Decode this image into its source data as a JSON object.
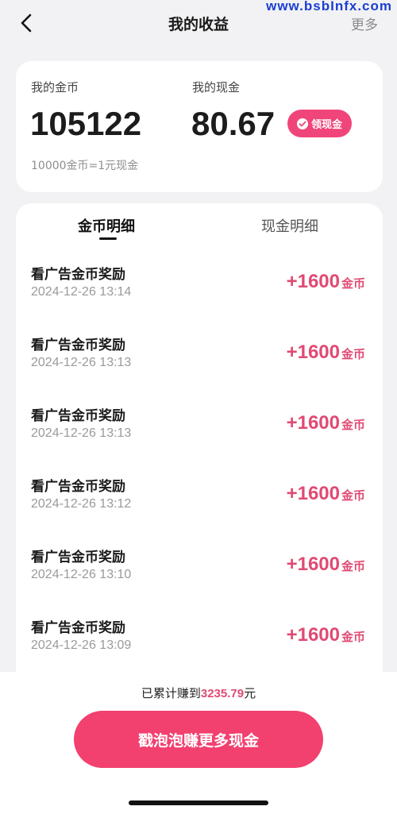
{
  "watermark": "www.bsbInfx.com",
  "nav": {
    "title": "我的收益",
    "more_label": "更多"
  },
  "summary": {
    "coins_label": "我的金币",
    "coins_value": "105122",
    "cash_label": "我的现金",
    "cash_value": "80.67",
    "claim_label": "领现金",
    "rate_text": "10000金币=1元现金"
  },
  "tabs": [
    {
      "label": "金币明细",
      "active": true
    },
    {
      "label": "现金明细",
      "active": false
    }
  ],
  "records": [
    {
      "title": "看广告金币奖励",
      "time": "2024-12-26 13:14",
      "amount": "+1600",
      "unit": "金币"
    },
    {
      "title": "看广告金币奖励",
      "time": "2024-12-26 13:13",
      "amount": "+1600",
      "unit": "金币"
    },
    {
      "title": "看广告金币奖励",
      "time": "2024-12-26 13:13",
      "amount": "+1600",
      "unit": "金币"
    },
    {
      "title": "看广告金币奖励",
      "time": "2024-12-26 13:12",
      "amount": "+1600",
      "unit": "金币"
    },
    {
      "title": "看广告金币奖励",
      "time": "2024-12-26 13:10",
      "amount": "+1600",
      "unit": "金币"
    },
    {
      "title": "看广告金币奖励",
      "time": "2024-12-26 13:09",
      "amount": "+1600",
      "unit": "金币"
    }
  ],
  "footer": {
    "total_prefix": "已累计赚到",
    "total_value": "3235.79",
    "total_suffix": "元",
    "cta_label": "戳泡泡赚更多现金"
  },
  "colors": {
    "accent": "#f0457a",
    "amount": "#e04a73",
    "background": "#f2f2f4"
  }
}
